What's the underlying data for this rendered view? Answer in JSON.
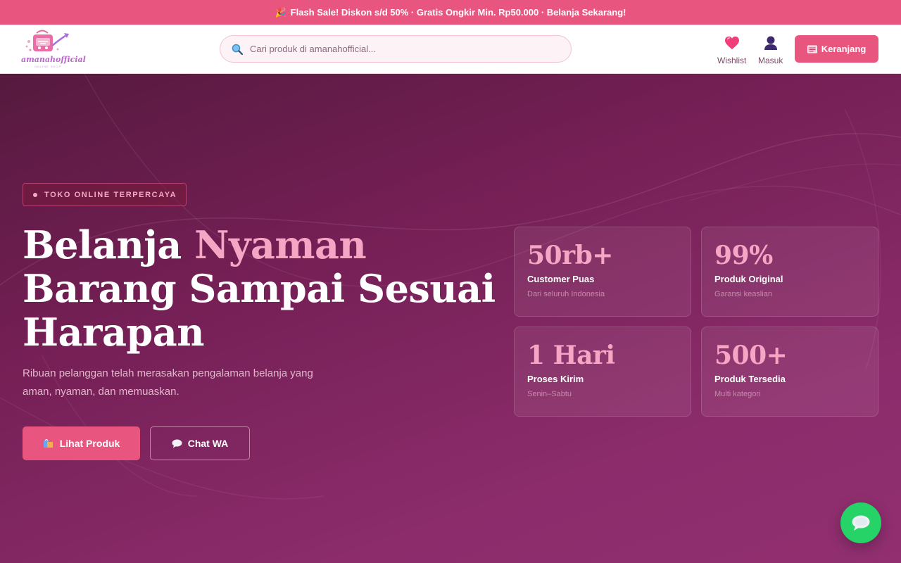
{
  "promo": {
    "text": "Flash Sale! Diskon s/d 50% · Gratis Ongkir Min. Rp50.000 · Belanja Sekarang!",
    "icon": "sparkle-icon"
  },
  "header": {
    "logo_text": "amanahofficial",
    "logo_subtext": "ONLINE SHOP",
    "search_placeholder": "Cari produk di amanahofficial...",
    "wishlist_label": "Wishlist",
    "login_label": "Masuk",
    "cart_label": "Keranjang"
  },
  "hero": {
    "badge": "TOKO ONLINE TERPERCAYA",
    "headline_part1": "Belanja ",
    "headline_accent": "Nyaman",
    "headline_line2": "Barang Sampai Sesuai",
    "headline_line3": "Harapan",
    "subtext": "Ribuan pelanggan telah merasakan pengalaman belanja yang aman, nyaman, dan memuaskan.",
    "primary_cta": "Lihat Produk",
    "secondary_cta": "Chat WA"
  },
  "stats": [
    {
      "number": "50rb+",
      "label": "Customer Puas",
      "desc": "Dari seluruh Indonesia"
    },
    {
      "number": "99%",
      "label": "Produk Original",
      "desc": "Garansi keaslian"
    },
    {
      "number": "1 Hari",
      "label": "Proses Kirim",
      "desc": "Senin–Sabtu"
    },
    {
      "number": "500+",
      "label": "Produk Tersedia",
      "desc": "Multi kategori"
    }
  ],
  "colors": {
    "accent": "#e8567f",
    "accent_light": "#f4a6c4",
    "hero_dark": "#561a3e",
    "hero_light": "#912f70",
    "whatsapp": "#25d366"
  },
  "icons": {
    "search": "search-icon",
    "wishlist": "heart-icon",
    "login": "user-icon",
    "cart": "cart-icon",
    "products": "shopping-bags-icon",
    "chat": "chat-bubble-icon",
    "whatsapp": "whatsapp-chat-icon"
  }
}
